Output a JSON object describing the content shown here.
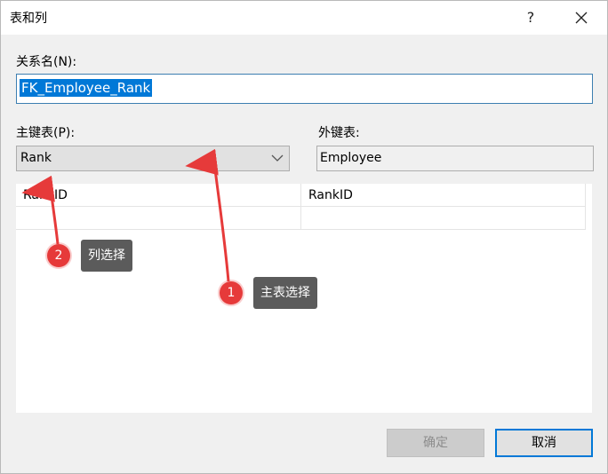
{
  "window": {
    "title": "表和列",
    "help_glyph": "?",
    "close_icon": "close-icon"
  },
  "relationship": {
    "label": "关系名(N):",
    "value": "FK_Employee_Rank"
  },
  "primary_key": {
    "label": "主键表(P):",
    "selected": "Rank"
  },
  "foreign_key": {
    "label": "外键表:",
    "value": "Employee"
  },
  "columns_grid": {
    "rows": [
      [
        "RankID",
        "RankID"
      ],
      [
        "",
        ""
      ]
    ]
  },
  "buttons": {
    "ok": "确定",
    "cancel": "取消"
  },
  "annotations": [
    {
      "number": "1",
      "text": "主表选择"
    },
    {
      "number": "2",
      "text": "列选择"
    }
  ],
  "colors": {
    "accent": "#0078d7",
    "annotation_red": "#e63a3a",
    "tooltip_bg": "#5b5b5b"
  }
}
